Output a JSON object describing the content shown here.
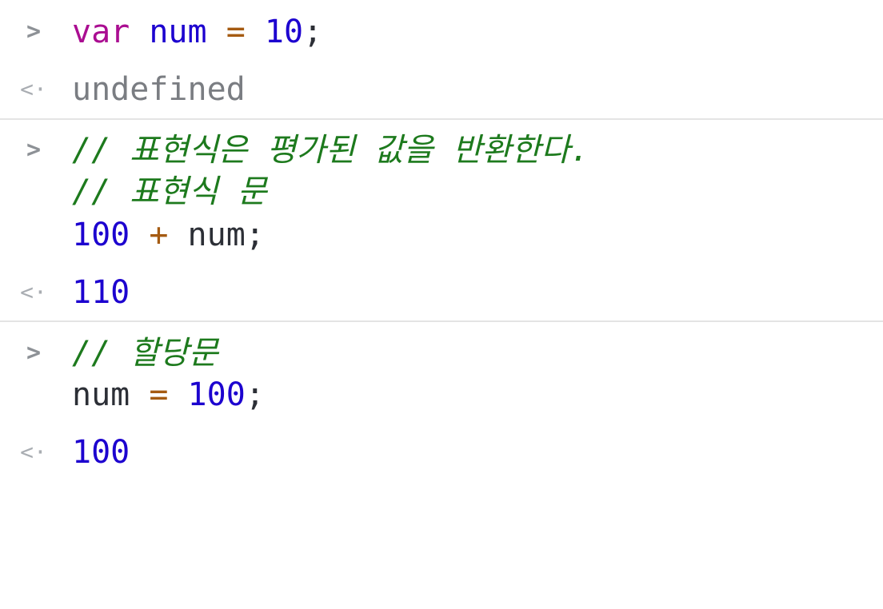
{
  "console": {
    "entries": [
      {
        "input": {
          "prompt_glyph": ">",
          "lines": [
            {
              "tokens": [
                "var",
                " ",
                "num",
                " ",
                "=",
                " ",
                "10",
                ";"
              ]
            }
          ]
        },
        "result": {
          "glyph": "<·",
          "value": "undefined"
        }
      },
      {
        "input": {
          "prompt_glyph": ">",
          "lines": [
            {
              "comment": "// 표현식은 평가된 값을 반환한다."
            },
            {
              "comment": "// 표현식 문"
            },
            {
              "tokens": [
                "100",
                " ",
                "+",
                " ",
                "num",
                ";"
              ]
            }
          ]
        },
        "result": {
          "glyph": "<·",
          "value": "110"
        }
      },
      {
        "input": {
          "prompt_glyph": ">",
          "lines": [
            {
              "comment": "// 할당문"
            },
            {
              "tokens": [
                "num",
                " ",
                "=",
                " ",
                "100",
                ";"
              ]
            }
          ]
        },
        "result": {
          "glyph": "<·",
          "value": "100"
        }
      }
    ]
  },
  "colors": {
    "keyword": "#aa0d91",
    "identifier": "#1c00cf",
    "operator": "#a55b12",
    "number": "#1c00cf",
    "comment": "#1d7a1d",
    "undefined": "#7a7d82",
    "gutter": "#9aa0a6",
    "separator": "#e4e4e4"
  }
}
